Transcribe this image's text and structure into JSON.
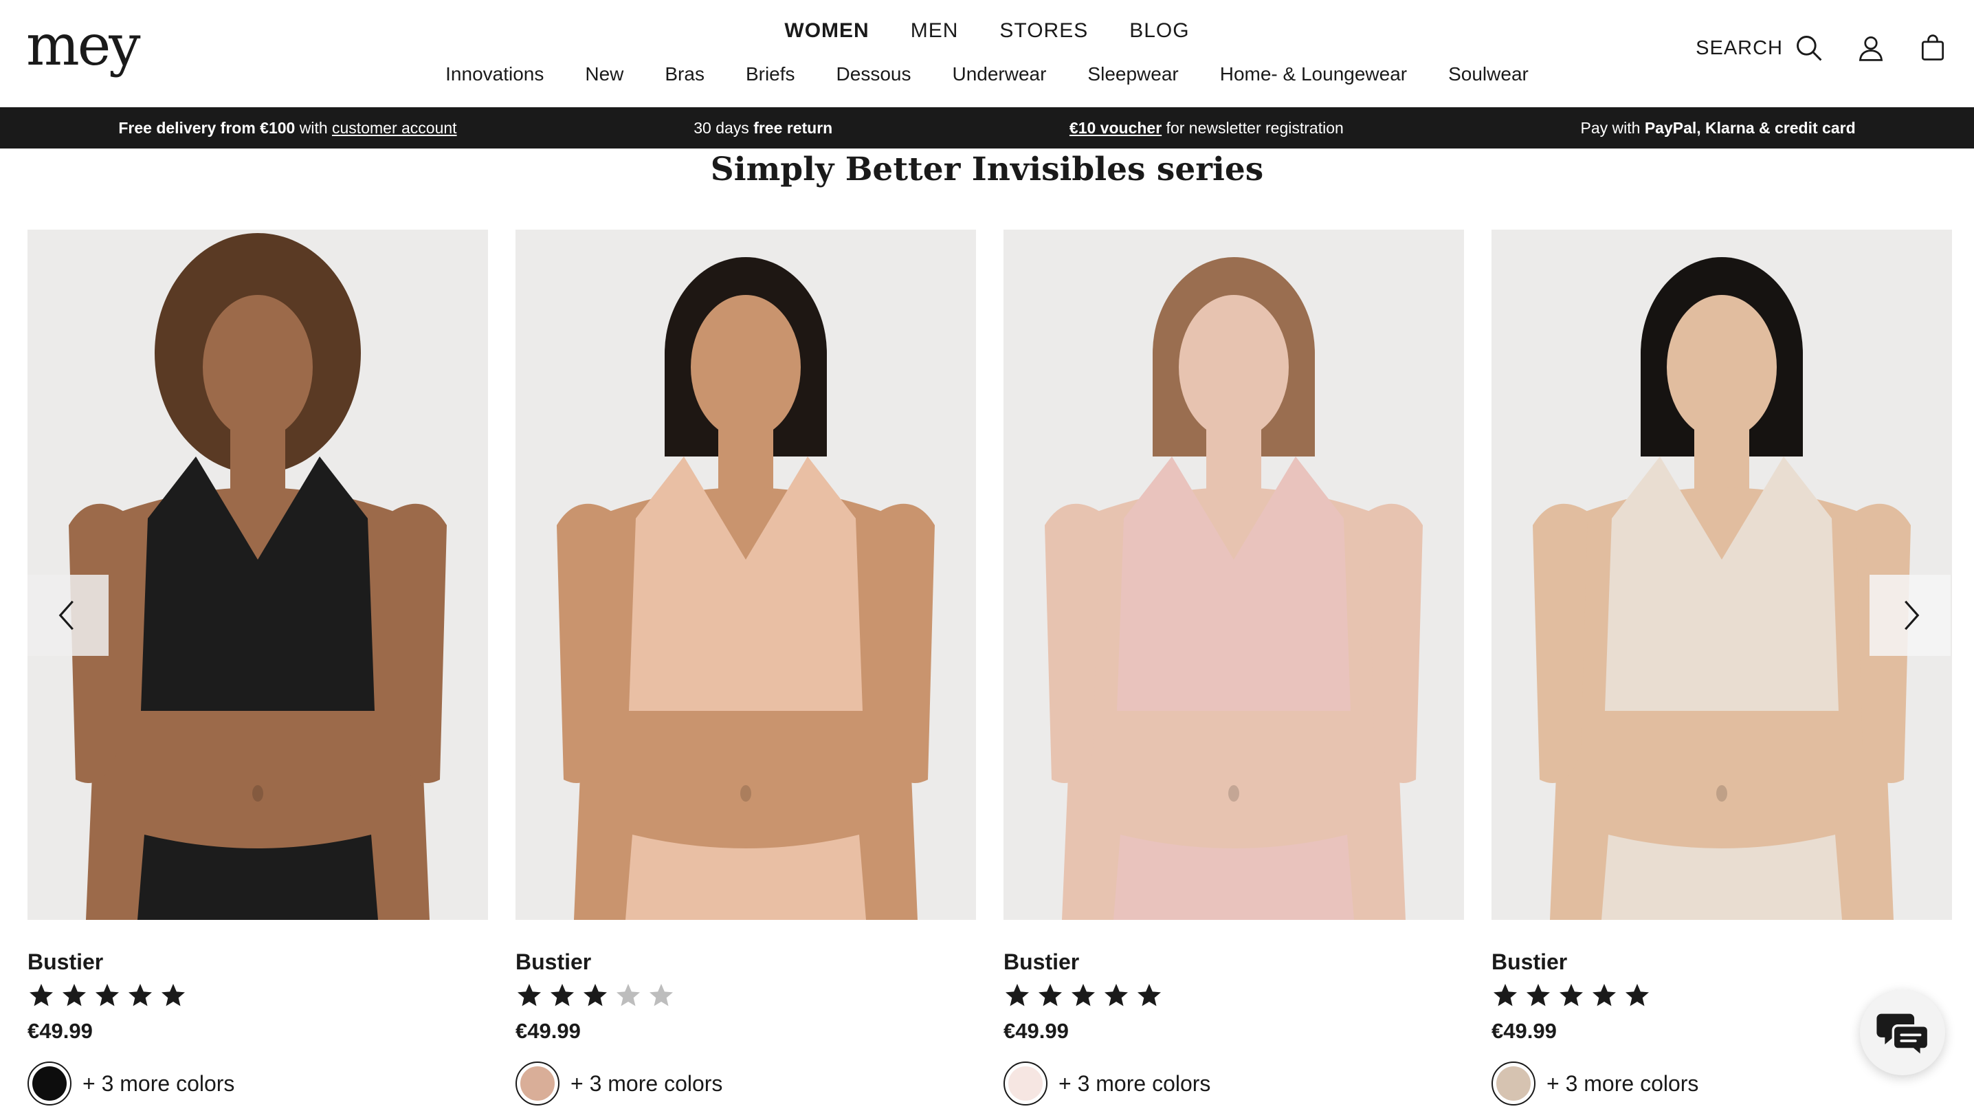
{
  "brand": {
    "logo": "mey"
  },
  "main_nav": [
    {
      "label": "WOMEN",
      "active": true
    },
    {
      "label": "MEN",
      "active": false
    },
    {
      "label": "STORES",
      "active": false
    },
    {
      "label": "BLOG",
      "active": false
    }
  ],
  "sub_nav": [
    "Innovations",
    "New",
    "Bras",
    "Briefs",
    "Dessous",
    "Underwear",
    "Sleepwear",
    "Home- & Loungewear",
    "Soulwear"
  ],
  "header_right": {
    "search_label": "SEARCH",
    "icons": [
      "search-icon",
      "account-icon",
      "bag-icon"
    ]
  },
  "promo_bar": [
    {
      "bold": "Free delivery from €100",
      "text": " with ",
      "link": "customer account"
    },
    {
      "text": "30 days ",
      "bold": "free return"
    },
    {
      "link_bold": "€10 voucher",
      "text": " for newsletter registration"
    },
    {
      "text": "Pay with ",
      "bold": "PayPal, Klarna & credit card"
    }
  ],
  "section": {
    "title": "Simply Better Invisibles series"
  },
  "products": [
    {
      "name": "Bustier",
      "rating": 5,
      "price": "€49.99",
      "more_colors": "+ 3 more colors",
      "swatch_color": "#0d0d0d",
      "garment_color": "#1c1c1c",
      "skin_color": "#9c6a4a",
      "hair_color": "#5a3a24"
    },
    {
      "name": "Bustier",
      "rating": 3,
      "price": "€49.99",
      "more_colors": "+ 3 more colors",
      "swatch_color": "#d9ae98",
      "garment_color": "#e9bfa4",
      "skin_color": "#c9946e",
      "hair_color": "#1e1713"
    },
    {
      "name": "Bustier",
      "rating": 5,
      "price": "€49.99",
      "more_colors": "+ 3 more colors",
      "swatch_color": "#f6e6e2",
      "garment_color": "#e9c3bd",
      "skin_color": "#e7c3b0",
      "hair_color": "#9a6e50"
    },
    {
      "name": "Bustier",
      "rating": 5,
      "price": "€49.99",
      "more_colors": "+ 3 more colors",
      "swatch_color": "#d6c3b1",
      "garment_color": "#e9ddd1",
      "skin_color": "#e1bd9f",
      "hair_color": "#161311"
    }
  ],
  "colors": {
    "promo_bg": "#1a1a1a",
    "text": "#1a1a1a",
    "photo_bg": "#ecebea",
    "star_on": "#1a1a1a",
    "star_off": "#bdbdbd"
  }
}
